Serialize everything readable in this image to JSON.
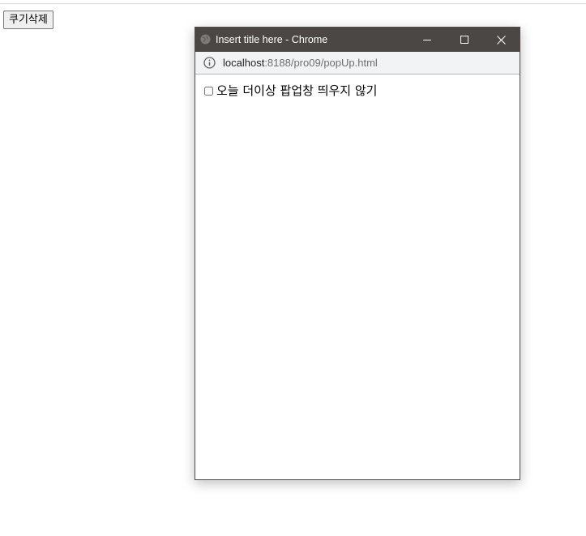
{
  "page": {
    "cookie_button_label": "쿠기삭제"
  },
  "popup": {
    "window_title": "Insert title here - Chrome",
    "url_host": "localhost",
    "url_path": ":8188/pro09/popUp.html",
    "checkbox_label": "오늘 더이상 팝업창 띄우지 않기",
    "checkbox_checked": false,
    "icons": {
      "title": "globe-icon",
      "minimize": "minimize-icon",
      "maximize": "maximize-icon",
      "close": "close-icon",
      "address": "info-icon"
    }
  },
  "colors": {
    "titlebar": "#4a4744",
    "addressbar": "#f1f3f4"
  }
}
